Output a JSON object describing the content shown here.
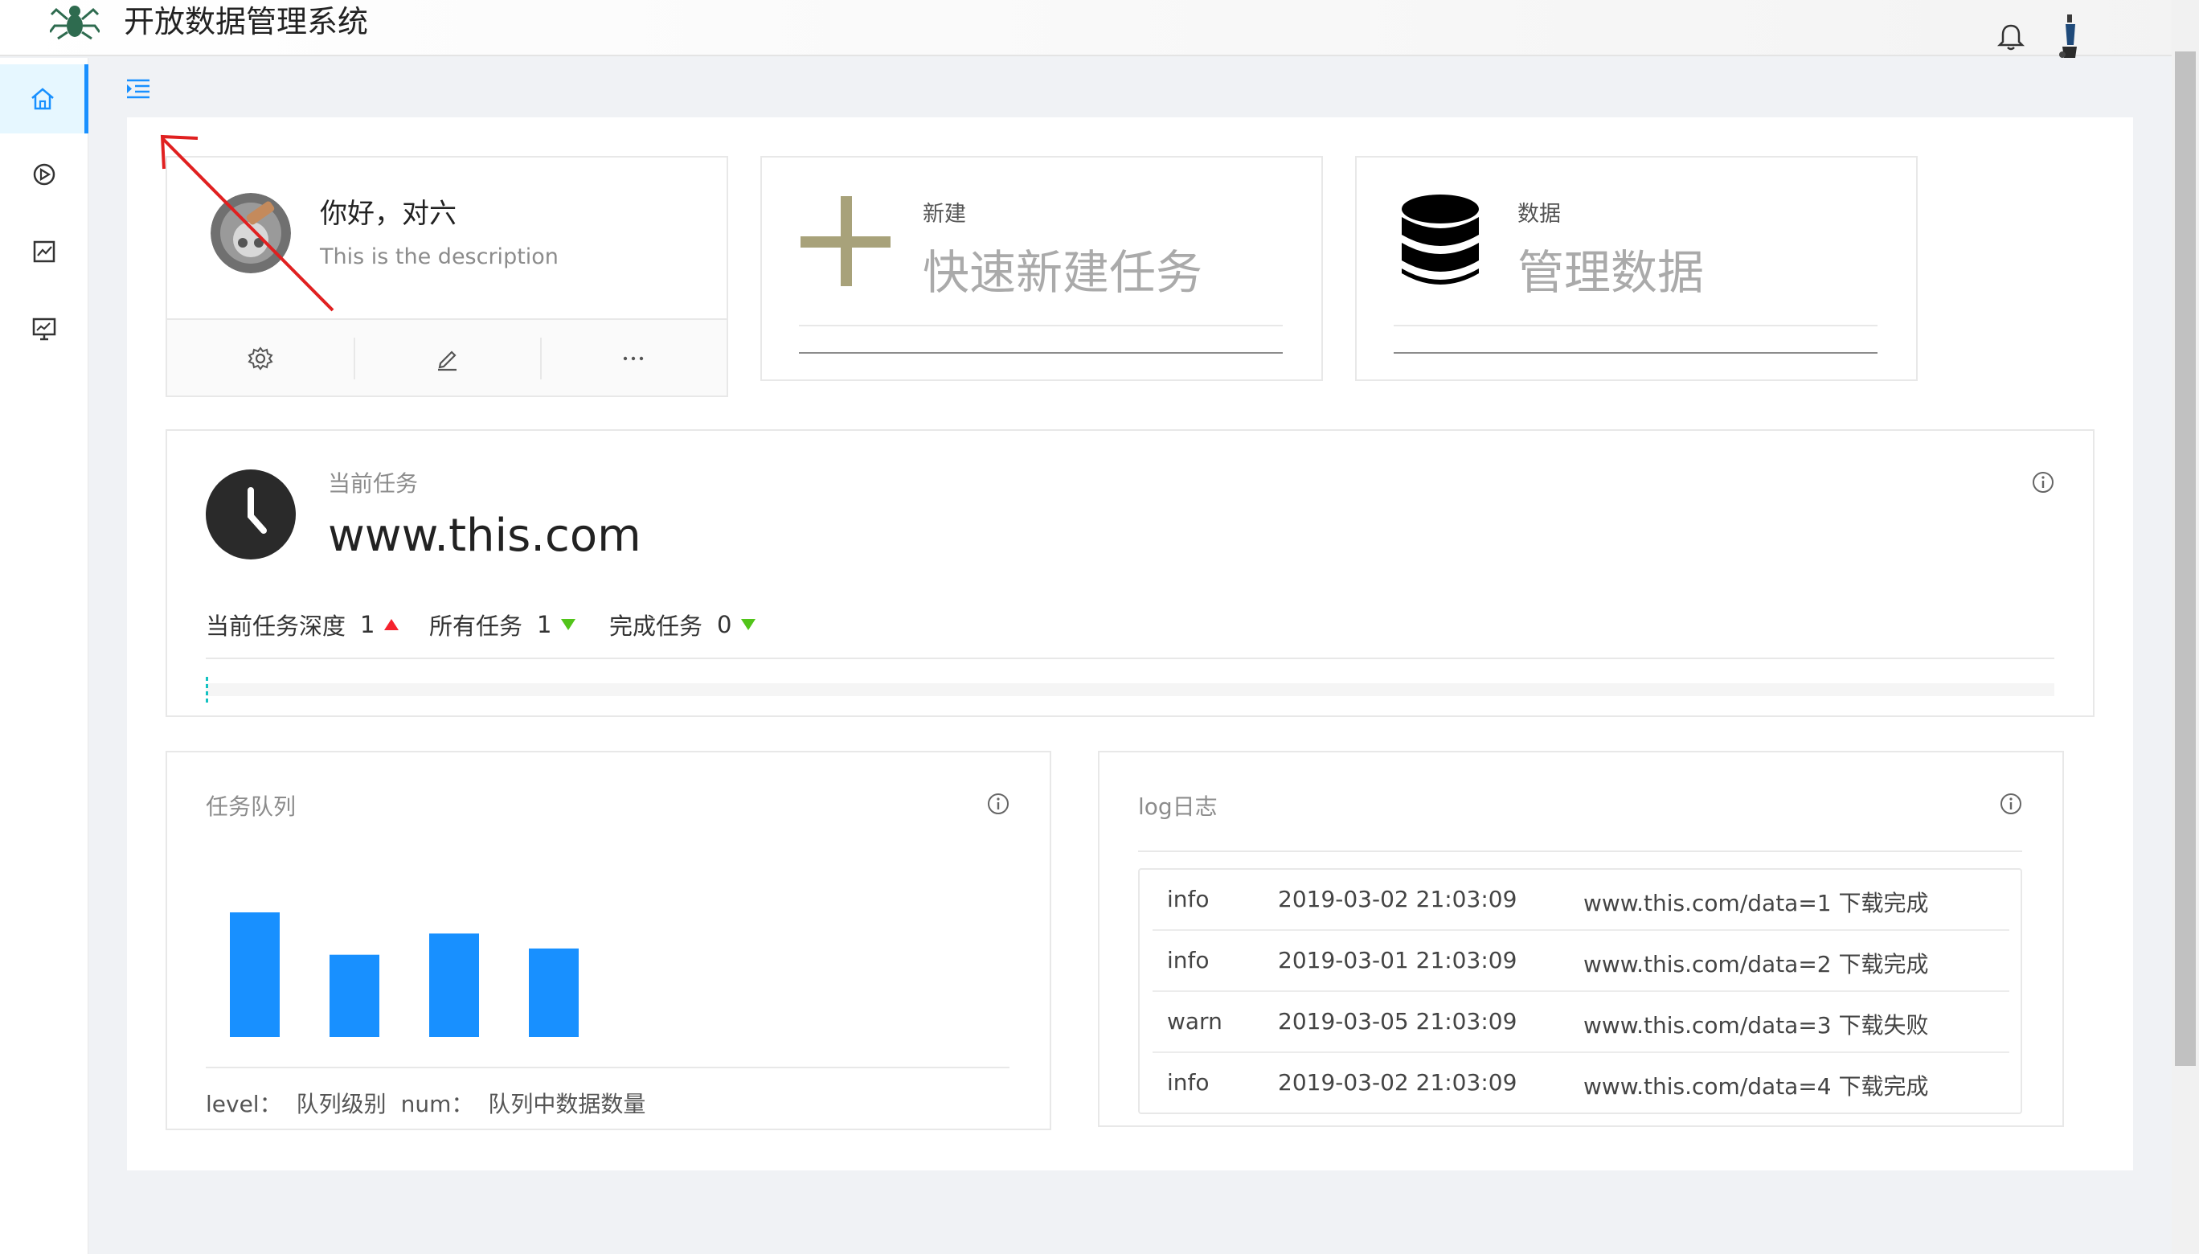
{
  "header": {
    "title": "开放数据管理系统"
  },
  "sidebar": {
    "items": [
      {
        "name": "home",
        "icon": "home-icon"
      },
      {
        "name": "tasks",
        "icon": "play-circle-icon"
      },
      {
        "name": "data",
        "icon": "chart-box-icon"
      },
      {
        "name": "monitor",
        "icon": "screen-chart-icon"
      }
    ]
  },
  "user": {
    "greeting": "你好，对六",
    "description": "This is the description",
    "actions": [
      "setting-icon",
      "edit-icon",
      "ellipsis-icon"
    ]
  },
  "quick": {
    "new": {
      "label": "新建",
      "title": "快速新建任务"
    },
    "data": {
      "label": "数据",
      "title": "管理数据"
    }
  },
  "task": {
    "label": "当前任务",
    "url": "www.this.com",
    "stats": [
      {
        "label": "当前任务深度",
        "value": "1",
        "trend": "up"
      },
      {
        "label": "所有任务",
        "value": "1",
        "trend": "down"
      },
      {
        "label": "完成任务",
        "value": "0",
        "trend": "down"
      }
    ],
    "progress": 0
  },
  "queue": {
    "title": "任务队列",
    "legend_level_key": "level：",
    "legend_level_val": "队列级别",
    "legend_num_key": "num：",
    "legend_num_val": "队列中数据数量"
  },
  "chart_data": {
    "type": "bar",
    "categories": [
      "",
      "",
      "",
      ""
    ],
    "values": [
      100,
      66,
      83,
      71
    ],
    "ylim": [
      0,
      100
    ],
    "title": "",
    "xlabel": "",
    "ylabel": "",
    "grid": false
  },
  "log": {
    "title": "log日志",
    "rows": [
      {
        "level": "info",
        "time": "2019-03-02 21:03:09",
        "msg": "www.this.com/data=1 下载完成"
      },
      {
        "level": "info",
        "time": "2019-03-01 21:03:09",
        "msg": "www.this.com/data=2 下载完成"
      },
      {
        "level": "warn",
        "time": "2019-03-05 21:03:09",
        "msg": "www.this.com/data=3 下载失败"
      },
      {
        "level": "info",
        "time": "2019-03-02 21:03:09",
        "msg": "www.this.com/data=4 下载完成"
      }
    ]
  },
  "colors": {
    "accent": "#1890ff",
    "bar": "#1890ff",
    "plus": "#a8a27a",
    "arrow": "#e02020",
    "up": "#f5222d",
    "down": "#52c41a"
  }
}
